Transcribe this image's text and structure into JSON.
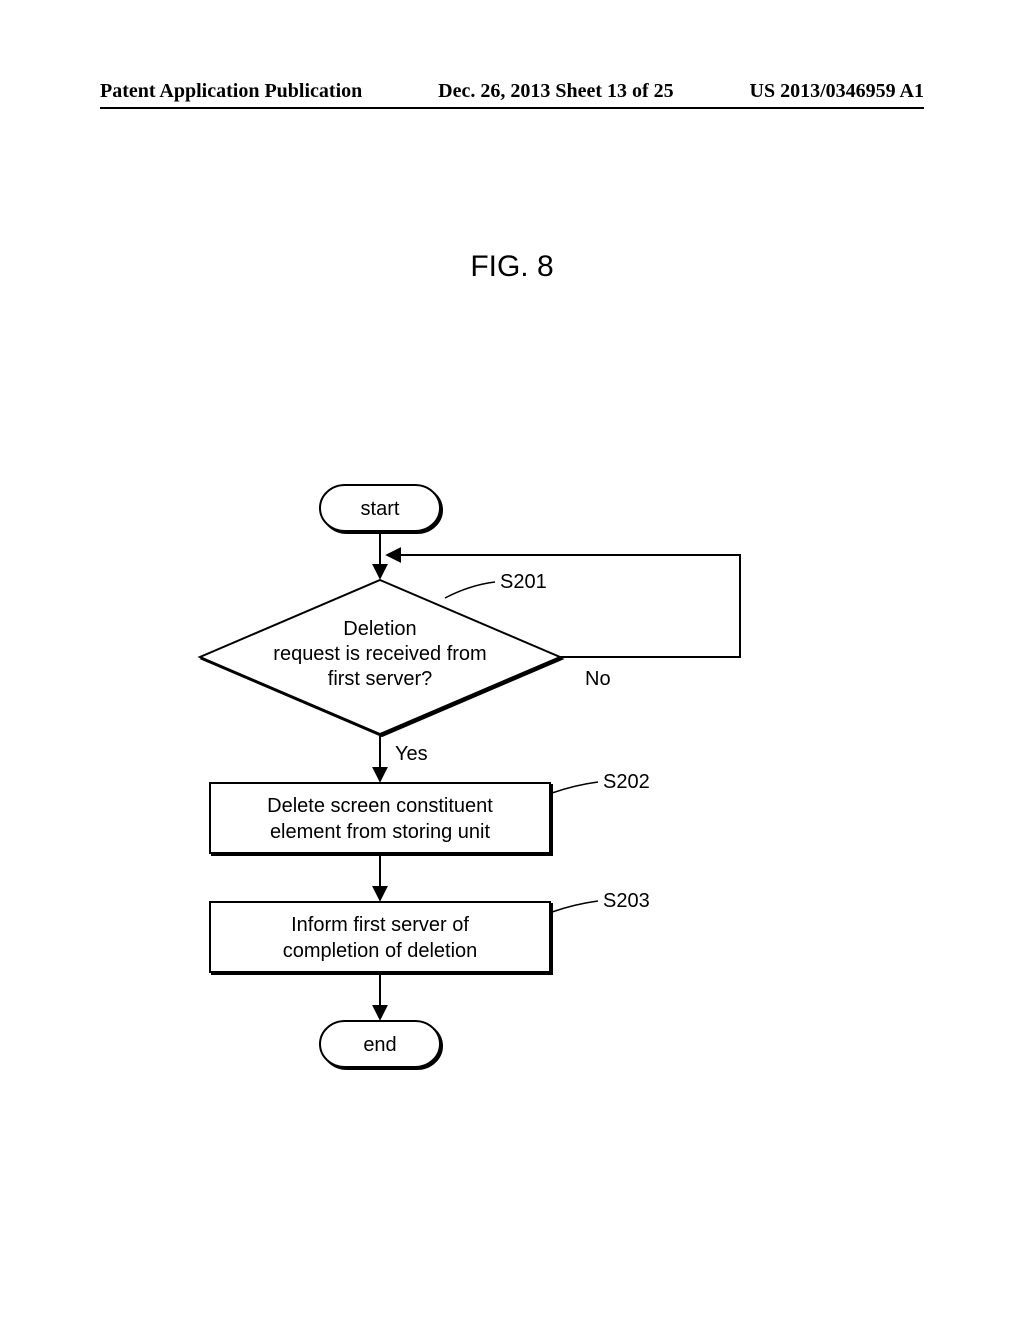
{
  "header": {
    "left": "Patent Application Publication",
    "center": "Dec. 26, 2013  Sheet 13 of 25",
    "right": "US 2013/0346959 A1"
  },
  "figure": {
    "title": "FIG. 8",
    "start": "start",
    "end": "end",
    "decision": {
      "label": "S201",
      "line1": "Deletion",
      "line2": "request is received from",
      "line3": "first server?",
      "yes": "Yes",
      "no": "No"
    },
    "step1": {
      "label": "S202",
      "line1": "Delete screen constituent",
      "line2": "element from storing unit"
    },
    "step2": {
      "label": "S203",
      "line1": "Inform first server of",
      "line2": "completion of deletion"
    }
  }
}
